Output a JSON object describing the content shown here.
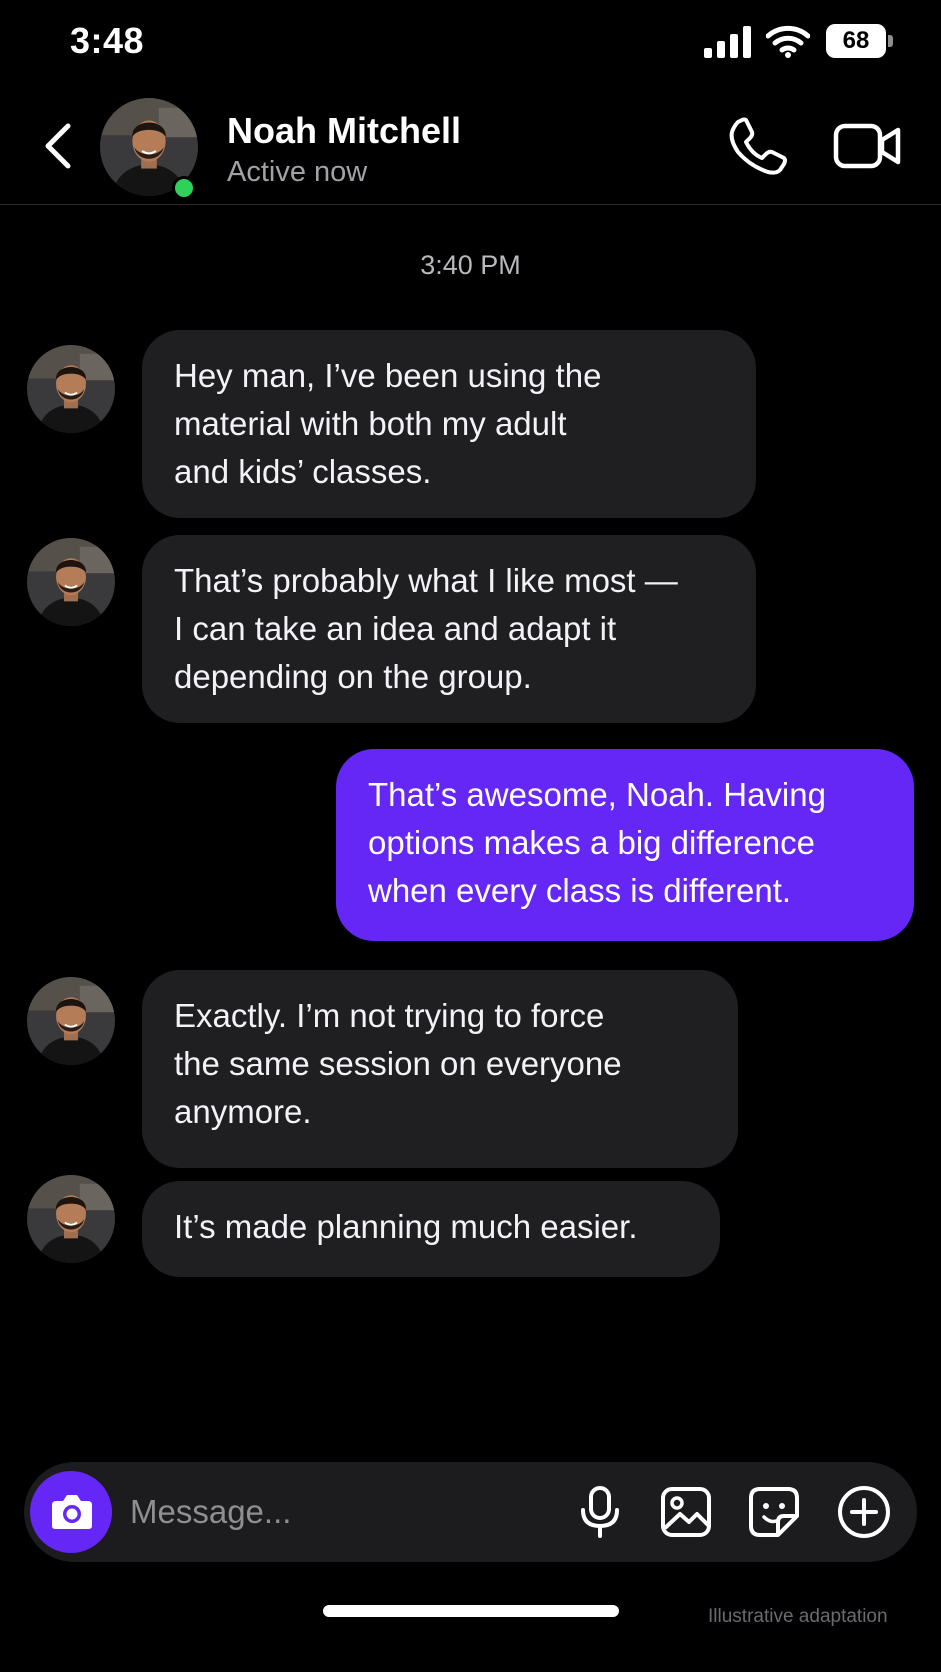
{
  "status_bar": {
    "time": "3:48",
    "battery": "68"
  },
  "header": {
    "contact_name": "Noah Mitchell",
    "presence": "Active now"
  },
  "conversation": {
    "timestamp": "3:40 PM",
    "messages": [
      {
        "direction": "incoming",
        "text": "Hey man, I’ve been using the\nmaterial with both my adult\nand kids’ classes."
      },
      {
        "direction": "incoming",
        "text": "That’s probably what I like most —\nI can take an idea and adapt it\ndepending on the group."
      },
      {
        "direction": "outgoing",
        "text": "That’s awesome, Noah. Having\noptions makes a big difference\nwhen every class is different."
      },
      {
        "direction": "incoming",
        "text": "Exactly. I’m not trying to force\nthe same session on everyone\nanymore."
      },
      {
        "direction": "incoming",
        "text": "It’s made planning much easier."
      }
    ]
  },
  "composer": {
    "placeholder": "Message..."
  },
  "footer": {
    "watermark": "Illustrative adaptation"
  },
  "colors": {
    "accent": "#6527f5",
    "online": "#30d158",
    "incoming_bubble": "#1f1f22",
    "background": "#000000"
  },
  "icons": [
    "chevron-left-icon",
    "phone-icon",
    "video-camera-icon",
    "camera-icon",
    "microphone-icon",
    "image-icon",
    "sticker-icon",
    "plus-circle-icon"
  ]
}
